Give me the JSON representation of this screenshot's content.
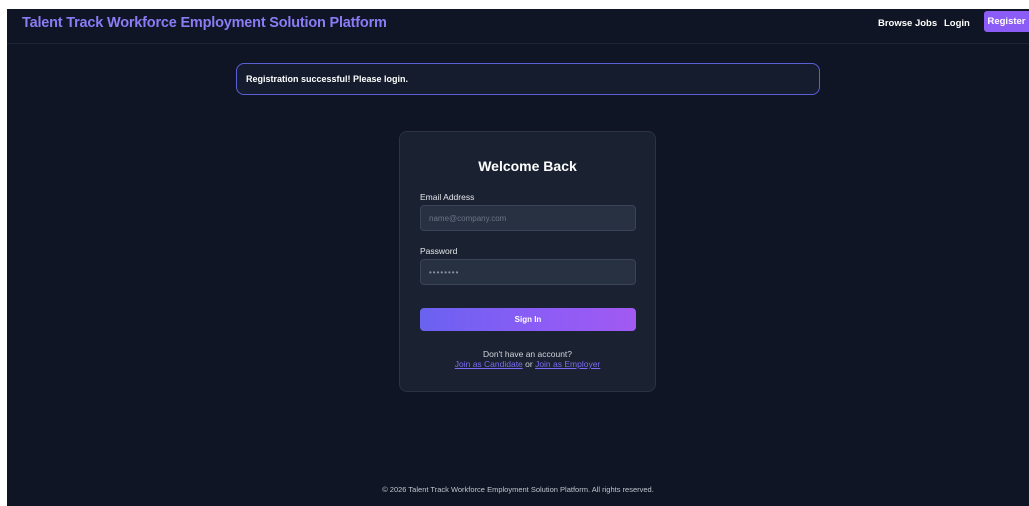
{
  "header": {
    "brand": "Talent Track Workforce Employment Solution Platform",
    "nav": {
      "browse_jobs": "Browse Jobs",
      "login": "Login",
      "register": "Register"
    }
  },
  "alert": {
    "message": "Registration successful! Please login."
  },
  "login_card": {
    "title": "Welcome Back",
    "email": {
      "label": "Email Address",
      "placeholder": "name@company.com",
      "value": ""
    },
    "password": {
      "label": "Password",
      "placeholder": "••••••••",
      "value": ""
    },
    "submit_label": "Sign In",
    "signup_prompt": "Don't have an account?",
    "join_candidate": "Join as Candidate",
    "join_separator": " or ",
    "join_employer": "Join as Employer"
  },
  "footer": {
    "text": "© 2026 Talent Track Workforce Employment Solution Platform. All rights reserved."
  },
  "colors": {
    "background": "#0f1524",
    "card": "#1a2131",
    "accent": "#8b5cf6",
    "brand": "#8b7cf5",
    "alert_border": "#5b5fd6"
  }
}
